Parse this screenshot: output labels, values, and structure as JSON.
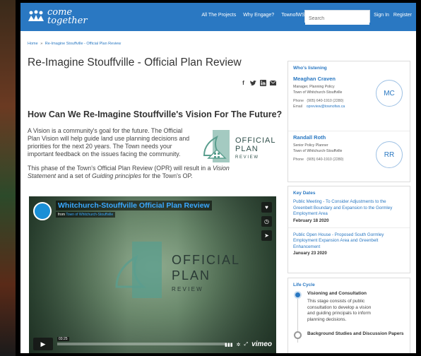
{
  "header": {
    "logo_line1": "come",
    "logo_line2": "together",
    "nav": [
      "All The Projects",
      "Why Engage?",
      "TownofWS.ca"
    ],
    "search_placeholder": "Search",
    "sign_in": "Sign In",
    "register": "Register",
    "bar_color": "#2a78c2"
  },
  "breadcrumb": {
    "home": "Home",
    "separator": "»",
    "current": "Re-Imagine Stouffville - Official Plan Review"
  },
  "page": {
    "title": "Re-Imagine Stouffville - Official Plan Review",
    "share_icons": [
      "facebook-icon",
      "twitter-icon",
      "linkedin-icon",
      "email-icon"
    ],
    "subtitle": "How Can We Re-Imagine Stouffville's Vision For The Future?",
    "intro": "A Vision is a community's goal for the future. The Official Plan Vision will help guide land use planning decisions and priorities for the next 20 years. The Town needs your important feedback on the issues facing the community.",
    "intro2_a": "This phase of the Town's Official Plan Review (OPR) will result in a ",
    "intro2_em1": "Vision Statement",
    "intro2_b": " and a set of ",
    "intro2_em2": "Guiding principles",
    "intro2_c": " for the Town's OP.",
    "logo_word1": "OFFICIAL",
    "logo_word2": "PLAN",
    "logo_word3": "R E V I E W",
    "logo_color": "#5a9e8e"
  },
  "video": {
    "title": "Whitchurch-Stouffville Official Plan Review",
    "from_label": "from",
    "from_channel": "Town of Whitchurch-Stouffville",
    "logo_word1": "OFFICIAL",
    "logo_word2": "PLAN",
    "logo_word3": "R E V I E W",
    "time": "03:25",
    "vimeo": "vimeo"
  },
  "sidebar": {
    "listening_heading": "Who's listening",
    "people": [
      {
        "name": "Meaghan Craven",
        "role_line1": "Manager, Planning Policy",
        "role_line2": "Town of Whitchurch-Stouffville",
        "phone_label": "Phone",
        "phone": "(905) 640-1910 (2280)",
        "email_label": "Email",
        "email": "opreview@townofws.ca",
        "initials": "MC"
      },
      {
        "name": "Randall Roth",
        "role_line1": "Senior Policy Planner",
        "role_line2": "Town of Whitchurch-Stouffville",
        "phone_label": "Phone",
        "phone": "(905) 640-1910 (2280)",
        "initials": "RR"
      }
    ],
    "dates_heading": "Key Dates",
    "dates": [
      {
        "title": "Public Meeting - To Consider Adjustments to the Greenbelt Boundary and Expansion to the Gormley Employment Area",
        "date": "February 18 2020"
      },
      {
        "title": "Public Open House - Proposed South Gormley Employment Expansion Area and Greenbelt Enhancement",
        "date": "January 23 2020"
      }
    ],
    "life_heading": "Life Cycle",
    "stages": [
      {
        "title": "Visioning and Consultation",
        "desc": "This stage consists of public consultation to develop a vision and guiding principals to inform planning decisions."
      },
      {
        "title": "Background Studies and Discussion Papers"
      }
    ]
  }
}
